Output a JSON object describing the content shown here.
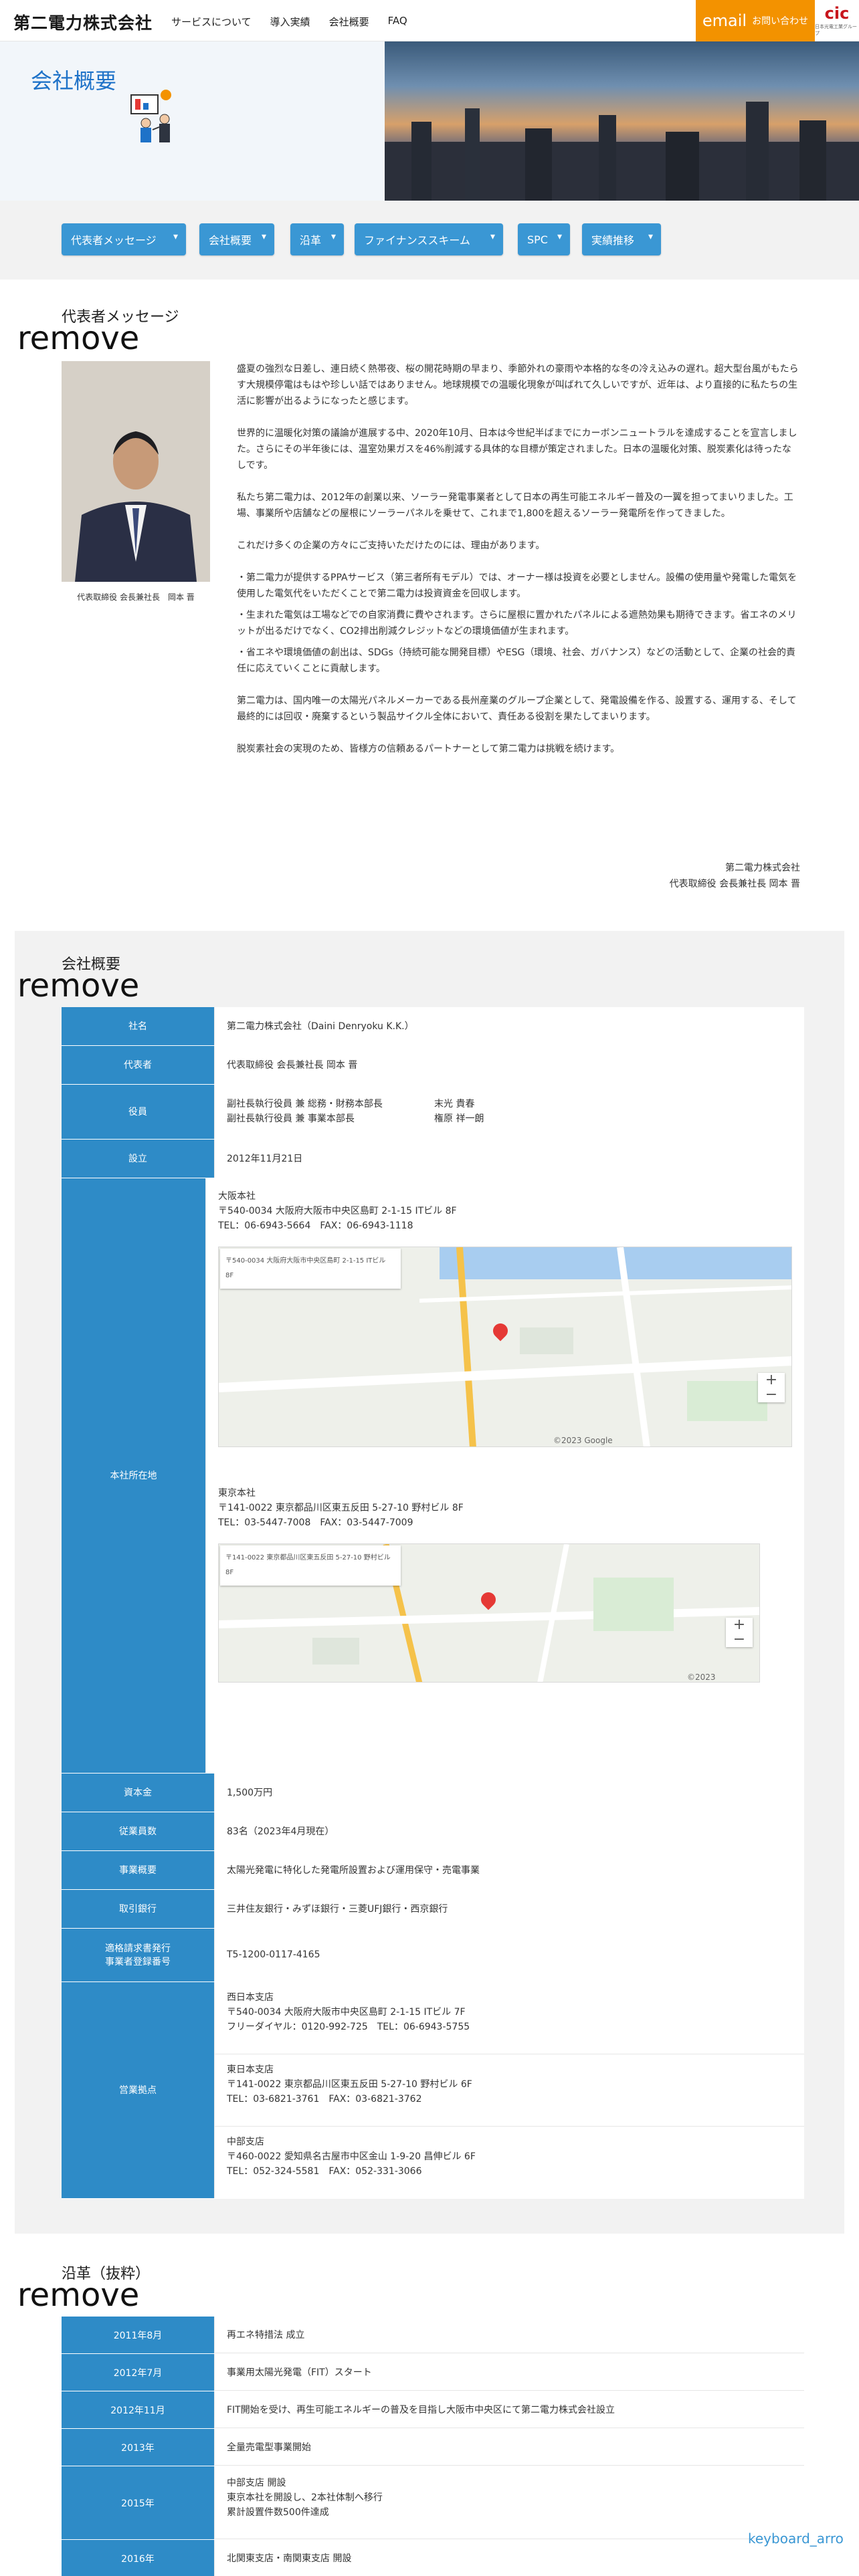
{
  "header": {
    "logo": "第二電力株式会社",
    "nav": [
      "サービスについて",
      "導入実績",
      "会社概要",
      "FAQ"
    ],
    "contact_email": "email",
    "contact_label": "お問い合わせ",
    "cic_logo": "cic",
    "cic_sub": "日本光電工業グループ"
  },
  "hero": {
    "title": "会社概要"
  },
  "tabs": [
    "代表者メッセージ",
    "会社概要",
    "沿革",
    "ファイナンススキーム",
    "SPC",
    "実績推移"
  ],
  "message": {
    "heading_jp": "代表者メッセージ",
    "heading_en": "remove",
    "photo_caption": "代表取締役 会長兼社長　岡本 晋",
    "paragraphs": [
      "盛夏の強烈な日差し、連日続く熱帯夜、桜の開花時期の早まり、季節外れの豪雨や本格的な冬の冷え込みの遅れ。超大型台風がもたらす大規模停電はもはや珍しい話ではありません。地球規模での温暖化現象が叫ばれて久しいですが、近年は、より直接的に私たちの生活に影響が出るようになったと感じます。",
      "世界的に温暖化対策の議論が進展する中、2020年10月、日本は今世紀半ばまでにカーボンニュートラルを達成することを宣言しました。さらにその半年後には、温室効果ガスを46%削減する具体的な目標が策定されました。日本の温暖化対策、脱炭素化は待ったなしです。",
      "私たち第二電力は、2012年の創業以来、ソーラー発電事業者として日本の再生可能エネルギー普及の一翼を担ってまいりました。工場、事業所や店舗などの屋根にソーラーパネルを乗せて、これまで1,800を超えるソーラー発電所を作ってきました。",
      "これだけ多くの企業の方々にご支持いただけたのには、理由があります。",
      "・第二電力が提供するPPAサービス（第三者所有モデル）では、オーナー様は投資を必要としません。設備の使用量や発電した電気を使用した電気代をいただくことで第二電力は投資資金を回収します。",
      "・生まれた電気は工場などでの自家消費に費やされます。さらに屋根に置かれたパネルによる遮熱効果も期待できます。省エネのメリットが出るだけでなく、CO2排出削減クレジットなどの環境価値が生まれます。",
      "・省エネや環境価値の創出は、SDGs（持続可能な開発目標）やESG（環境、社会、ガバナンス）などの活動として、企業の社会的責任に応えていくことに貢献します。",
      "第二電力は、国内唯一の太陽光パネルメーカーである長州産業のグループ企業として、発電設備を作る、設置する、運用する、そして最終的には回収・廃棄するという製品サイクル全体において、責任ある役割を果たしてまいります。",
      "脱炭素社会の実現のため、皆様方の信頼あるパートナーとして第二電力は挑戦を続けます。"
    ],
    "signature_company": "第二電力株式会社",
    "signature_name": "代表取締役 会長兼社長 岡本 晋"
  },
  "overview": {
    "heading_jp": "会社概要",
    "heading_en": "remove",
    "rows": {
      "name_label": "社名",
      "name": "第二電力株式会社（Daini Denryoku K.K.）",
      "rep_label": "代表者",
      "rep": "代表取締役 会長兼社長 岡本 晋",
      "officer_label": "役員",
      "officer1_title": "副社長執行役員 兼 総務・財務本部長",
      "officer1_name": "末光 貴春",
      "officer2_title": "副社長執行役員 兼 事業本部長",
      "officer2_name": "権原 祥一朗",
      "est_label": "設立",
      "est": "2012年11月21日",
      "hq_label": "本社所在地",
      "osaka_title": "大阪本社",
      "osaka_addr": "〒540-0034 大阪府大阪市中央区島町 2-1-15 ITビル 8F",
      "osaka_tel": "TEL：06-6943-5664　FAX：06-6943-1118",
      "osaka_map_card": "〒540-0034 大阪府大阪市中央区島町 2-1-15 ITビル 8F",
      "tokyo_title": "東京本社",
      "tokyo_addr": "〒141-0022 東京都品川区東五反田 5-27-10 野村ビル 8F",
      "tokyo_tel": "TEL：03-5447-7008　FAX：03-5447-7009",
      "tokyo_map_card": "〒141-0022 東京都品川区東五反田 5-27-10 野村ビル 8F",
      "map_attr1": "©2023 Google",
      "map_attr2": "©2023",
      "capital_label": "資本金",
      "capital": "1,500万円",
      "staff_label": "従業員数",
      "staff": "83名（2023年4月現在）",
      "biz_label": "事業概要",
      "biz": "太陽光発電に特化した発電所設置および運用保守・売電事業",
      "bank_label": "取引銀行",
      "bank": "三井住友銀行・みずほ銀行・三菱UFJ銀行・西京銀行",
      "invoice_label1": "適格請求書発行",
      "invoice_label2": "事業者登録番号",
      "invoice": "T5-1200-0117-4165",
      "branch_label": "営業拠点",
      "west_title": "西日本支店",
      "west_addr": "〒540-0034 大阪府大阪市中央区島町 2-1-15 ITビル 7F",
      "west_tel": "フリーダイヤル：0120-992-725　TEL：06-6943-5755",
      "east_title": "東日本支店",
      "east_addr": "〒141-0022 東京都品川区東五反田 5-27-10 野村ビル 6F",
      "east_tel": "TEL：03-6821-3761　FAX：03-6821-3762",
      "chubu_title": "中部支店",
      "chubu_addr": "〒460-0022 愛知県名古屋市中区金山 1-9-20 昌伸ビル 6F",
      "chubu_tel": "TEL：052-324-5581　FAX：052-331-3066"
    }
  },
  "history": {
    "heading_jp": "沿革（抜粋）",
    "heading_en": "remove",
    "rows": [
      {
        "date": "2011年8月",
        "lines": [
          "再エネ特措法 成立"
        ]
      },
      {
        "date": "2012年7月",
        "lines": [
          "事業用太陽光発電（FIT）スタート"
        ]
      },
      {
        "date": "2012年11月",
        "lines": [
          "FIT開始を受け、再生可能エネルギーの普及を目指し大阪市中央区にて第二電力株式会社設立"
        ]
      },
      {
        "date": "2013年",
        "lines": [
          "全量売電型事業開始"
        ]
      },
      {
        "date": "2015年",
        "lines": [
          "中部支店 開設",
          "東京本社を開設し、2本社体制へ移行",
          "累計設置件数500件達成"
        ]
      },
      {
        "date": "2016年",
        "lines": [
          "北関東支店・南関東支店 開設"
        ]
      }
    ]
  },
  "to_top": "keyboard_arro"
}
